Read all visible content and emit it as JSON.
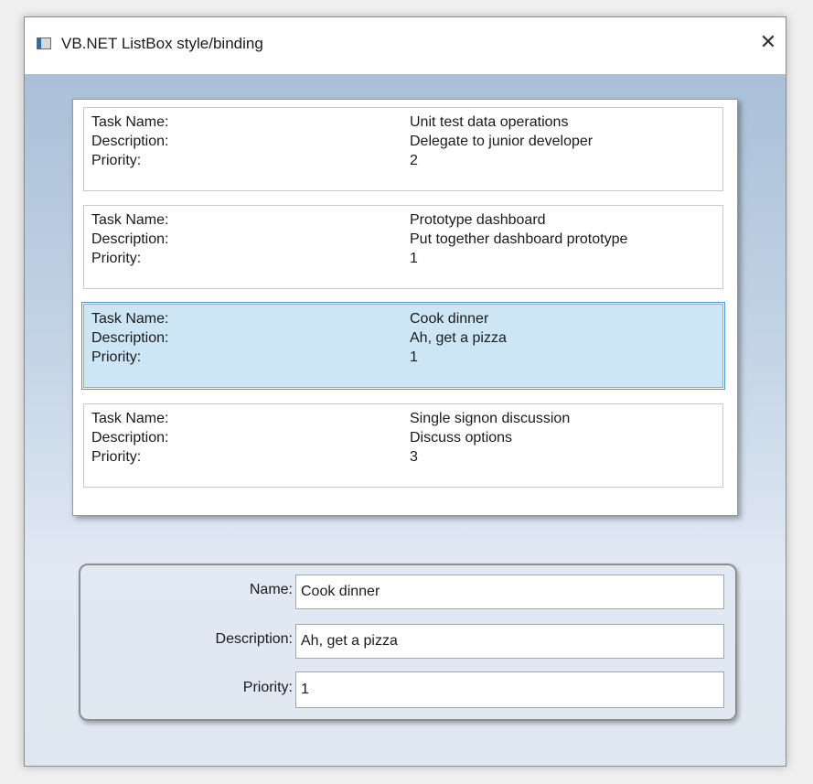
{
  "window": {
    "title": "VB.NET ListBox style/binding",
    "close_glyph": "✕"
  },
  "list": {
    "labels": {
      "name": "Task Name:",
      "description": "Description:",
      "priority": "Priority:"
    },
    "items": [
      {
        "name": "Unit test data operations",
        "description": "Delegate to junior developer",
        "priority": "2",
        "selected": false
      },
      {
        "name": "Prototype dashboard",
        "description": "Put together dashboard prototype",
        "priority": "1",
        "selected": false
      },
      {
        "name": "Cook dinner",
        "description": "Ah, get a pizza",
        "priority": "1",
        "selected": true
      },
      {
        "name": "Single signon discussion",
        "description": "Discuss options",
        "priority": "3",
        "selected": false
      }
    ]
  },
  "editor": {
    "name_label": "Name:",
    "name_value": "Cook dinner",
    "description_label": "Description:",
    "description_value": "Ah, get a pizza",
    "priority_label": "Priority:",
    "priority_value": "1"
  },
  "colors": {
    "selection_background": "#cce6f5",
    "selection_border": "#3c9fd8",
    "client_gradient_top": "#a9c0d8",
    "client_gradient_bottom": "#e1e9f4"
  },
  "icons": {
    "app": "window-app-icon",
    "close": "close-icon"
  }
}
